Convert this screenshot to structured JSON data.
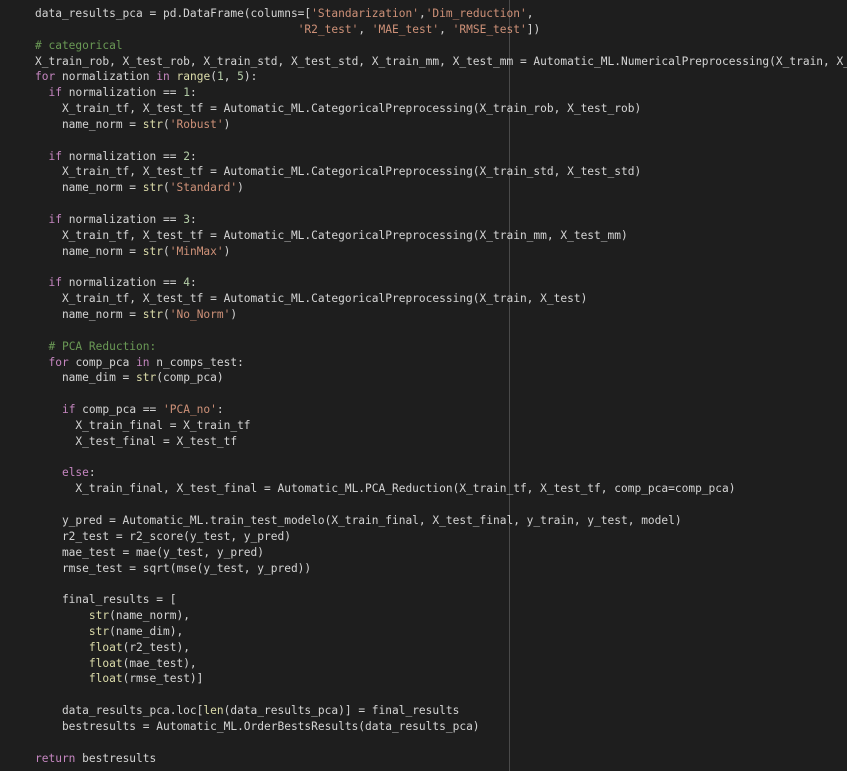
{
  "editor": {
    "language": "python",
    "theme_colors": {
      "background": "#1e1e1e",
      "default": "#d4d4d4",
      "keyword": "#c586c0",
      "builtin": "#dcdcaa",
      "string": "#ce9178",
      "number": "#b5cea8",
      "comment": "#6a9955",
      "ruler": "#4a4a4a"
    },
    "lines": [
      [
        {
          "t": "data_results_pca = pd.DataFrame(columns=[",
          "k": "d"
        },
        {
          "t": "'Standarization'",
          "k": "s"
        },
        {
          "t": ",",
          "k": "d"
        },
        {
          "t": "'Dim_reduction'",
          "k": "s"
        },
        {
          "t": ",",
          "k": "d"
        }
      ],
      [
        {
          "t": "                                       ",
          "k": "d"
        },
        {
          "t": "'R2_test'",
          "k": "s"
        },
        {
          "t": ", ",
          "k": "d"
        },
        {
          "t": "'MAE_test'",
          "k": "s"
        },
        {
          "t": ", ",
          "k": "d"
        },
        {
          "t": "'RMSE_test'",
          "k": "s"
        },
        {
          "t": "])",
          "k": "d"
        }
      ],
      [
        {
          "t": "# categorical",
          "k": "c"
        }
      ],
      [
        {
          "t": "X_train_rob, X_test_rob, X_train_std, X_test_std, X_train_mm, X_test_mm = Automatic_ML.NumericalPreprocessing(X_train, X_test)",
          "k": "d"
        }
      ],
      [
        {
          "t": "for",
          "k": "k"
        },
        {
          "t": " normalization ",
          "k": "d"
        },
        {
          "t": "in",
          "k": "k"
        },
        {
          "t": " ",
          "k": "d"
        },
        {
          "t": "range",
          "k": "b"
        },
        {
          "t": "(",
          "k": "d"
        },
        {
          "t": "1",
          "k": "n"
        },
        {
          "t": ", ",
          "k": "d"
        },
        {
          "t": "5",
          "k": "n"
        },
        {
          "t": "):",
          "k": "d"
        }
      ],
      [
        {
          "t": "  ",
          "k": "d"
        },
        {
          "t": "if",
          "k": "k"
        },
        {
          "t": " normalization == ",
          "k": "d"
        },
        {
          "t": "1",
          "k": "n"
        },
        {
          "t": ":",
          "k": "d"
        }
      ],
      [
        {
          "t": "    X_train_tf, X_test_tf = Automatic_ML.CategoricalPreprocessing(X_train_rob, X_test_rob)",
          "k": "d"
        }
      ],
      [
        {
          "t": "    name_norm = ",
          "k": "d"
        },
        {
          "t": "str",
          "k": "b"
        },
        {
          "t": "(",
          "k": "d"
        },
        {
          "t": "'Robust'",
          "k": "s"
        },
        {
          "t": ")",
          "k": "d"
        }
      ],
      [],
      [
        {
          "t": "  ",
          "k": "d"
        },
        {
          "t": "if",
          "k": "k"
        },
        {
          "t": " normalization == ",
          "k": "d"
        },
        {
          "t": "2",
          "k": "n"
        },
        {
          "t": ":",
          "k": "d"
        }
      ],
      [
        {
          "t": "    X_train_tf, X_test_tf = Automatic_ML.CategoricalPreprocessing(X_train_std, X_test_std)",
          "k": "d"
        }
      ],
      [
        {
          "t": "    name_norm = ",
          "k": "d"
        },
        {
          "t": "str",
          "k": "b"
        },
        {
          "t": "(",
          "k": "d"
        },
        {
          "t": "'Standard'",
          "k": "s"
        },
        {
          "t": ")",
          "k": "d"
        }
      ],
      [],
      [
        {
          "t": "  ",
          "k": "d"
        },
        {
          "t": "if",
          "k": "k"
        },
        {
          "t": " normalization == ",
          "k": "d"
        },
        {
          "t": "3",
          "k": "n"
        },
        {
          "t": ":",
          "k": "d"
        }
      ],
      [
        {
          "t": "    X_train_tf, X_test_tf = Automatic_ML.CategoricalPreprocessing(X_train_mm, X_test_mm)",
          "k": "d"
        }
      ],
      [
        {
          "t": "    name_norm = ",
          "k": "d"
        },
        {
          "t": "str",
          "k": "b"
        },
        {
          "t": "(",
          "k": "d"
        },
        {
          "t": "'MinMax'",
          "k": "s"
        },
        {
          "t": ")",
          "k": "d"
        }
      ],
      [],
      [
        {
          "t": "  ",
          "k": "d"
        },
        {
          "t": "if",
          "k": "k"
        },
        {
          "t": " normalization == ",
          "k": "d"
        },
        {
          "t": "4",
          "k": "n"
        },
        {
          "t": ":",
          "k": "d"
        }
      ],
      [
        {
          "t": "    X_train_tf, X_test_tf = Automatic_ML.CategoricalPreprocessing(X_train, X_test)",
          "k": "d"
        }
      ],
      [
        {
          "t": "    name_norm = ",
          "k": "d"
        },
        {
          "t": "str",
          "k": "b"
        },
        {
          "t": "(",
          "k": "d"
        },
        {
          "t": "'No_Norm'",
          "k": "s"
        },
        {
          "t": ")",
          "k": "d"
        }
      ],
      [],
      [
        {
          "t": "  ",
          "k": "d"
        },
        {
          "t": "# PCA Reduction:",
          "k": "c"
        }
      ],
      [
        {
          "t": "  ",
          "k": "d"
        },
        {
          "t": "for",
          "k": "k"
        },
        {
          "t": " comp_pca ",
          "k": "d"
        },
        {
          "t": "in",
          "k": "k"
        },
        {
          "t": " n_comps_test:",
          "k": "d"
        }
      ],
      [
        {
          "t": "    name_dim = ",
          "k": "d"
        },
        {
          "t": "str",
          "k": "b"
        },
        {
          "t": "(comp_pca)",
          "k": "d"
        }
      ],
      [],
      [
        {
          "t": "    ",
          "k": "d"
        },
        {
          "t": "if",
          "k": "k"
        },
        {
          "t": " comp_pca == ",
          "k": "d"
        },
        {
          "t": "'PCA_no'",
          "k": "s"
        },
        {
          "t": ":",
          "k": "d"
        }
      ],
      [
        {
          "t": "      X_train_final = X_train_tf",
          "k": "d"
        }
      ],
      [
        {
          "t": "      X_test_final = X_test_tf",
          "k": "d"
        }
      ],
      [],
      [
        {
          "t": "    ",
          "k": "d"
        },
        {
          "t": "else",
          "k": "k"
        },
        {
          "t": ":",
          "k": "d"
        }
      ],
      [
        {
          "t": "      X_train_final, X_test_final = Automatic_ML.PCA_Reduction(X_train_tf, X_test_tf, comp_pca=comp_pca)",
          "k": "d"
        }
      ],
      [],
      [
        {
          "t": "    y_pred = Automatic_ML.train_test_modelo(X_train_final, X_test_final, y_train, y_test, model)",
          "k": "d"
        }
      ],
      [
        {
          "t": "    r2_test = r2_score(y_test, y_pred)",
          "k": "d"
        }
      ],
      [
        {
          "t": "    mae_test = mae(y_test, y_pred)",
          "k": "d"
        }
      ],
      [
        {
          "t": "    rmse_test = sqrt(mse(y_test, y_pred))",
          "k": "d"
        }
      ],
      [],
      [
        {
          "t": "    final_results = [",
          "k": "d"
        }
      ],
      [
        {
          "t": "        ",
          "k": "d"
        },
        {
          "t": "str",
          "k": "b"
        },
        {
          "t": "(name_norm),",
          "k": "d"
        }
      ],
      [
        {
          "t": "        ",
          "k": "d"
        },
        {
          "t": "str",
          "k": "b"
        },
        {
          "t": "(name_dim),",
          "k": "d"
        }
      ],
      [
        {
          "t": "        ",
          "k": "d"
        },
        {
          "t": "float",
          "k": "b"
        },
        {
          "t": "(r2_test),",
          "k": "d"
        }
      ],
      [
        {
          "t": "        ",
          "k": "d"
        },
        {
          "t": "float",
          "k": "b"
        },
        {
          "t": "(mae_test),",
          "k": "d"
        }
      ],
      [
        {
          "t": "        ",
          "k": "d"
        },
        {
          "t": "float",
          "k": "b"
        },
        {
          "t": "(rmse_test)]",
          "k": "d"
        }
      ],
      [],
      [
        {
          "t": "    data_results_pca.loc[",
          "k": "d"
        },
        {
          "t": "len",
          "k": "b"
        },
        {
          "t": "(data_results_pca)] = final_results",
          "k": "d"
        }
      ],
      [
        {
          "t": "    bestresults = Automatic_ML.OrderBestsResults(data_results_pca)",
          "k": "d"
        }
      ],
      [],
      [
        {
          "t": "return",
          "k": "k"
        },
        {
          "t": " bestresults",
          "k": "d"
        }
      ]
    ]
  }
}
